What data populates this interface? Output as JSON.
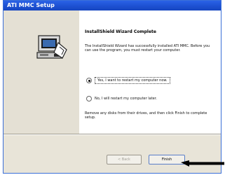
{
  "window": {
    "title": "ATI MMC Setup"
  },
  "left_panel": {
    "icon": "installer-computer-icon"
  },
  "content": {
    "heading": "InstallShield Wizard Complete",
    "body": "The InstallShield Wizard has successfully installed ATI MMC. Before you can use the program, you must restart your computer.",
    "options": [
      {
        "label": "Yes, I want to restart my computer now.",
        "selected": true
      },
      {
        "label": "No, I will restart my computer later.",
        "selected": false
      }
    ],
    "footer": "Remove any disks from their drives, and then click Finish to complete setup."
  },
  "buttons": {
    "back": "< Back",
    "finish": "Finish"
  },
  "annotation": {
    "icon": "arrow-pointer-icon",
    "color": "#000000"
  }
}
